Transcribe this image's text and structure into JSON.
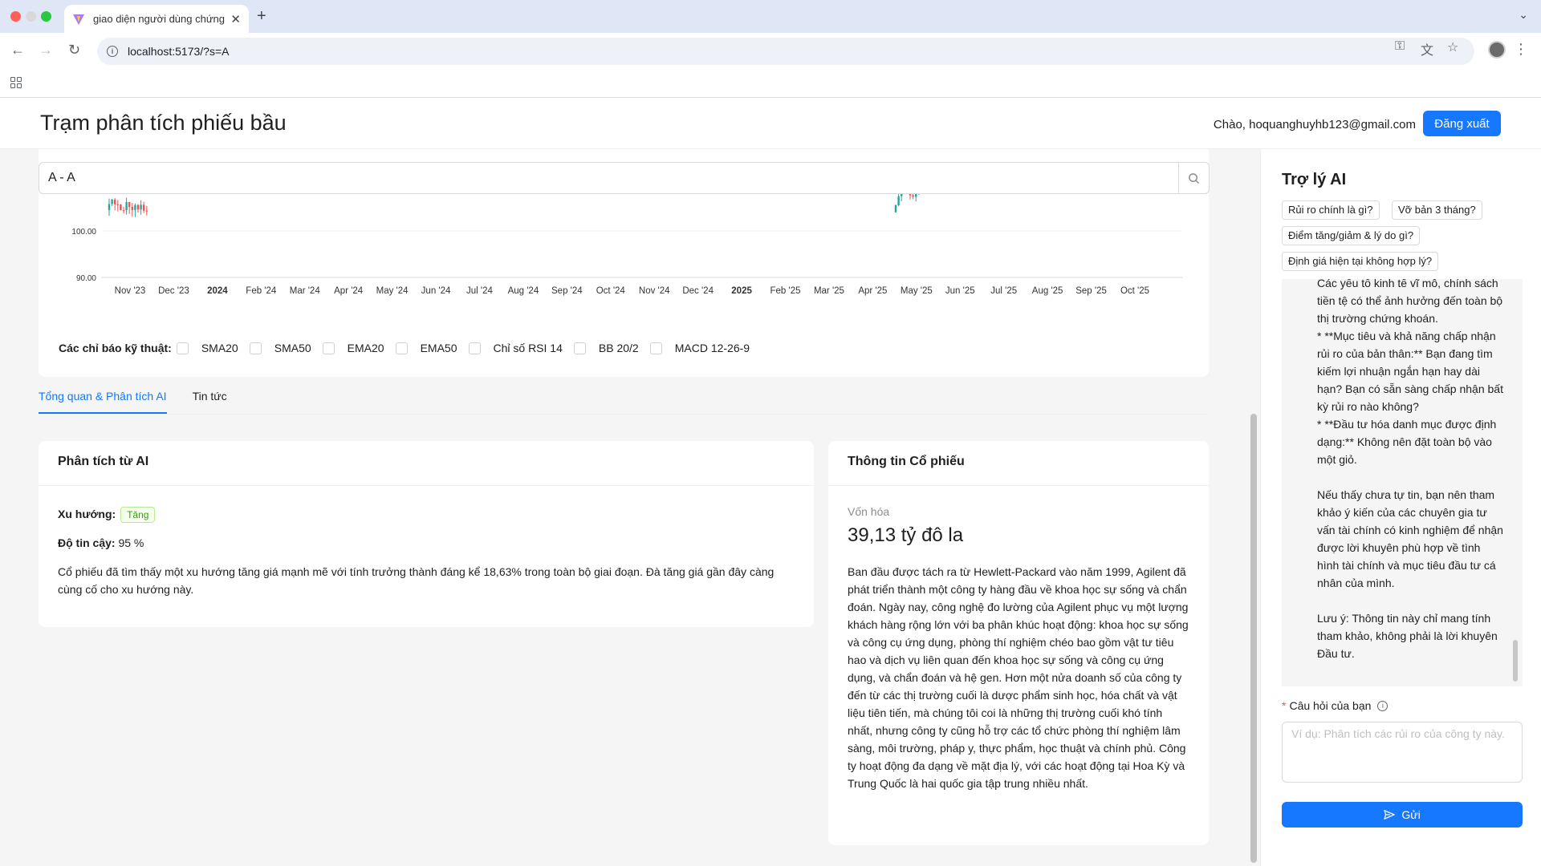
{
  "browser": {
    "tab_title": "giao diện người dùng chứng k",
    "url": "localhost:5173/?s=A"
  },
  "header": {
    "title": "Trạm phân tích phiếu bầu",
    "greeting": "Chào, hoquanghuyhb123@gmail.com",
    "logout_label": "Đăng xuất"
  },
  "search": {
    "value": "A - A"
  },
  "chart_data": {
    "type": "candlestick",
    "y_ticks": [
      "100.00",
      "90.00"
    ],
    "x_ticks": [
      "Nov '23",
      "Dec '23",
      "2024",
      "Feb '24",
      "Mar '24",
      "Apr '24",
      "May '24",
      "Jun '24",
      "Jul '24",
      "Aug '24",
      "Sep '24",
      "Oct '24",
      "Nov '24",
      "Dec '24",
      "2025",
      "Feb '25",
      "Mar '25",
      "Apr '25",
      "May '25",
      "Jun '25",
      "Jul '25",
      "Aug '25",
      "Sep '25",
      "Oct '25"
    ],
    "bold_ticks": [
      "2024",
      "2025"
    ],
    "ylim": [
      88,
      112
    ],
    "up_color": "#26a69a",
    "down_color": "#ef5350"
  },
  "indicators": {
    "label": "Các chỉ báo kỹ thuật:",
    "items": [
      "SMA20",
      "SMA50",
      "EMA20",
      "EMA50",
      "Chỉ số RSI 14",
      "BB 20/2",
      "MACD 12-26-9"
    ]
  },
  "tabs": [
    {
      "label": "Tổng quan & Phân tích AI",
      "active": true
    },
    {
      "label": "Tin tức",
      "active": false
    }
  ],
  "ai_analysis": {
    "title": "Phân tích từ AI",
    "trend_label": "Xu hướng:",
    "trend_value": "Tăng",
    "confidence_label": "Độ tin cậy:",
    "confidence_value": "95 %",
    "summary": "Cổ phiếu đã tìm thấy một xu hướng tăng giá mạnh mẽ với tính trưởng thành đáng kể 18,63% trong toàn bộ giai đoạn. Đà tăng giá gần đây càng cùng cố cho xu hướng này."
  },
  "stock_info": {
    "title": "Thông tin Cổ phiếu",
    "cap_label": "Vốn hóa",
    "cap_value": "39,13 tỷ đô la",
    "description": "Ban đầu được tách ra từ Hewlett-Packard vào năm 1999, Agilent đã phát triển thành một công ty hàng đầu về khoa học sự sống và chẩn đoán. Ngày nay, công nghệ đo lường của Agilent phục vụ một lượng khách hàng rộng lớn với ba phân khúc hoạt động: khoa học sự sống và công cụ ứng dụng, phòng thí nghiệm chéo bao gồm vật tư tiêu hao và dịch vụ liên quan đến khoa học sự sống và công cụ ứng dụng, và chẩn đoán và hệ gen. Hơn một nửa doanh số của công ty đến từ các thị trường cuối là dược phẩm sinh học, hóa chất và vật liệu tiên tiến, mà chúng tôi coi là những thị trường cuối khó tính nhất, nhưng công ty cũng hỗ trợ các tổ chức phòng thí nghiệm lâm sàng, môi trường, pháp y, thực phẩm, học thuật và chính phủ. Công ty hoạt động đa dạng về mặt địa lý, với các hoạt động tại Hoa Kỳ và Trung Quốc là hai quốc gia tập trung nhiều nhất."
  },
  "assistant": {
    "title": "Trợ lý AI",
    "suggestions": [
      "Rủi ro chính là gì?",
      "Vỡ bản 3 tháng?",
      "Điểm tăng/giảm & lý do gì?",
      "Định giá hiện tại không hợp lý?"
    ],
    "chat_text": "Các yếu tố kinh tế vĩ mô, chính sách tiền tệ có thể ảnh hưởng đến toàn bộ thị trường chứng khoán.\n* **Mục tiêu và khả năng chấp nhận rủi ro của bản thân:** Bạn đang tìm kiếm lợi nhuận ngắn hạn hay dài hạn? Bạn có sẵn sàng chấp nhận bất kỳ rủi ro nào không?\n* **Đầu tư hóa danh mục được định dạng:** Không nên đặt toàn bộ vào một giỏ.\n\nNếu thấy chưa tự tin, bạn nên tham khảo ý kiến của các chuyên gia tư vấn tài chính có kinh nghiệm để nhận được lời khuyên phù hợp về tình hình tài chính và mục tiêu đầu tư cá nhân của mình.\n\nLưu ý: Thông tin này chỉ mang tính tham khảo, không phải là lời khuyên Đầu tư.",
    "question_label": "Câu hỏi của bạn",
    "required_mark": "*",
    "question_placeholder": "Ví dụ: Phân tích các rủi ro của công ty này.",
    "send_label": "Gửi"
  }
}
